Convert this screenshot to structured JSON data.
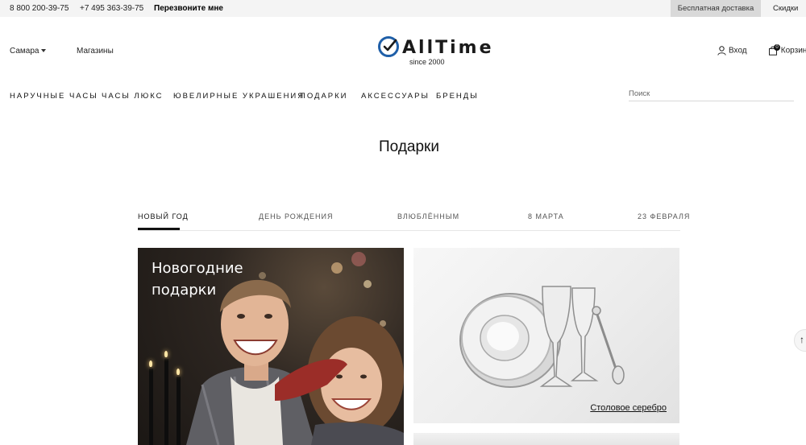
{
  "topbar": {
    "phone1": "8 800 200-39-75",
    "phone2": "+7 495 363-39-75",
    "callback": "Перезвоните мне",
    "delivery": "Бесплатная доставка",
    "discounts": "Скидки"
  },
  "header": {
    "city": "Самара",
    "stores": "Магазины",
    "logo_text": "AllTime",
    "logo_since": "since 2000",
    "login": "Вход",
    "cart": "Корзина",
    "cart_count": "0"
  },
  "nav": {
    "items": [
      "НАРУЧНЫЕ ЧАСЫ",
      "ЧАСЫ ЛЮКС",
      "ЮВЕЛИРНЫЕ УКРАШЕНИЯ",
      "ПОДАРКИ",
      "АКСЕССУАРЫ",
      "БРЕНДЫ"
    ],
    "search_placeholder": "Поиск"
  },
  "page": {
    "title": "Подарки"
  },
  "tabs": [
    "НОВЫЙ ГОД",
    "ДЕНЬ РОЖДЕНИЯ",
    "ВЛЮБЛЁННЫМ",
    "8 МАРТА",
    "23 ФЕВРАЛЯ"
  ],
  "banners": {
    "left_title_line1": "Новогодние",
    "left_title_line2": "подарки",
    "right_caption": "Столовое серебро"
  },
  "scroll_top": "↑",
  "colors": {
    "topbar_bg": "#f4f4f4",
    "delivery_bg": "#d9d9d9",
    "logo_blue": "#1f5fa8",
    "text": "#111111"
  }
}
